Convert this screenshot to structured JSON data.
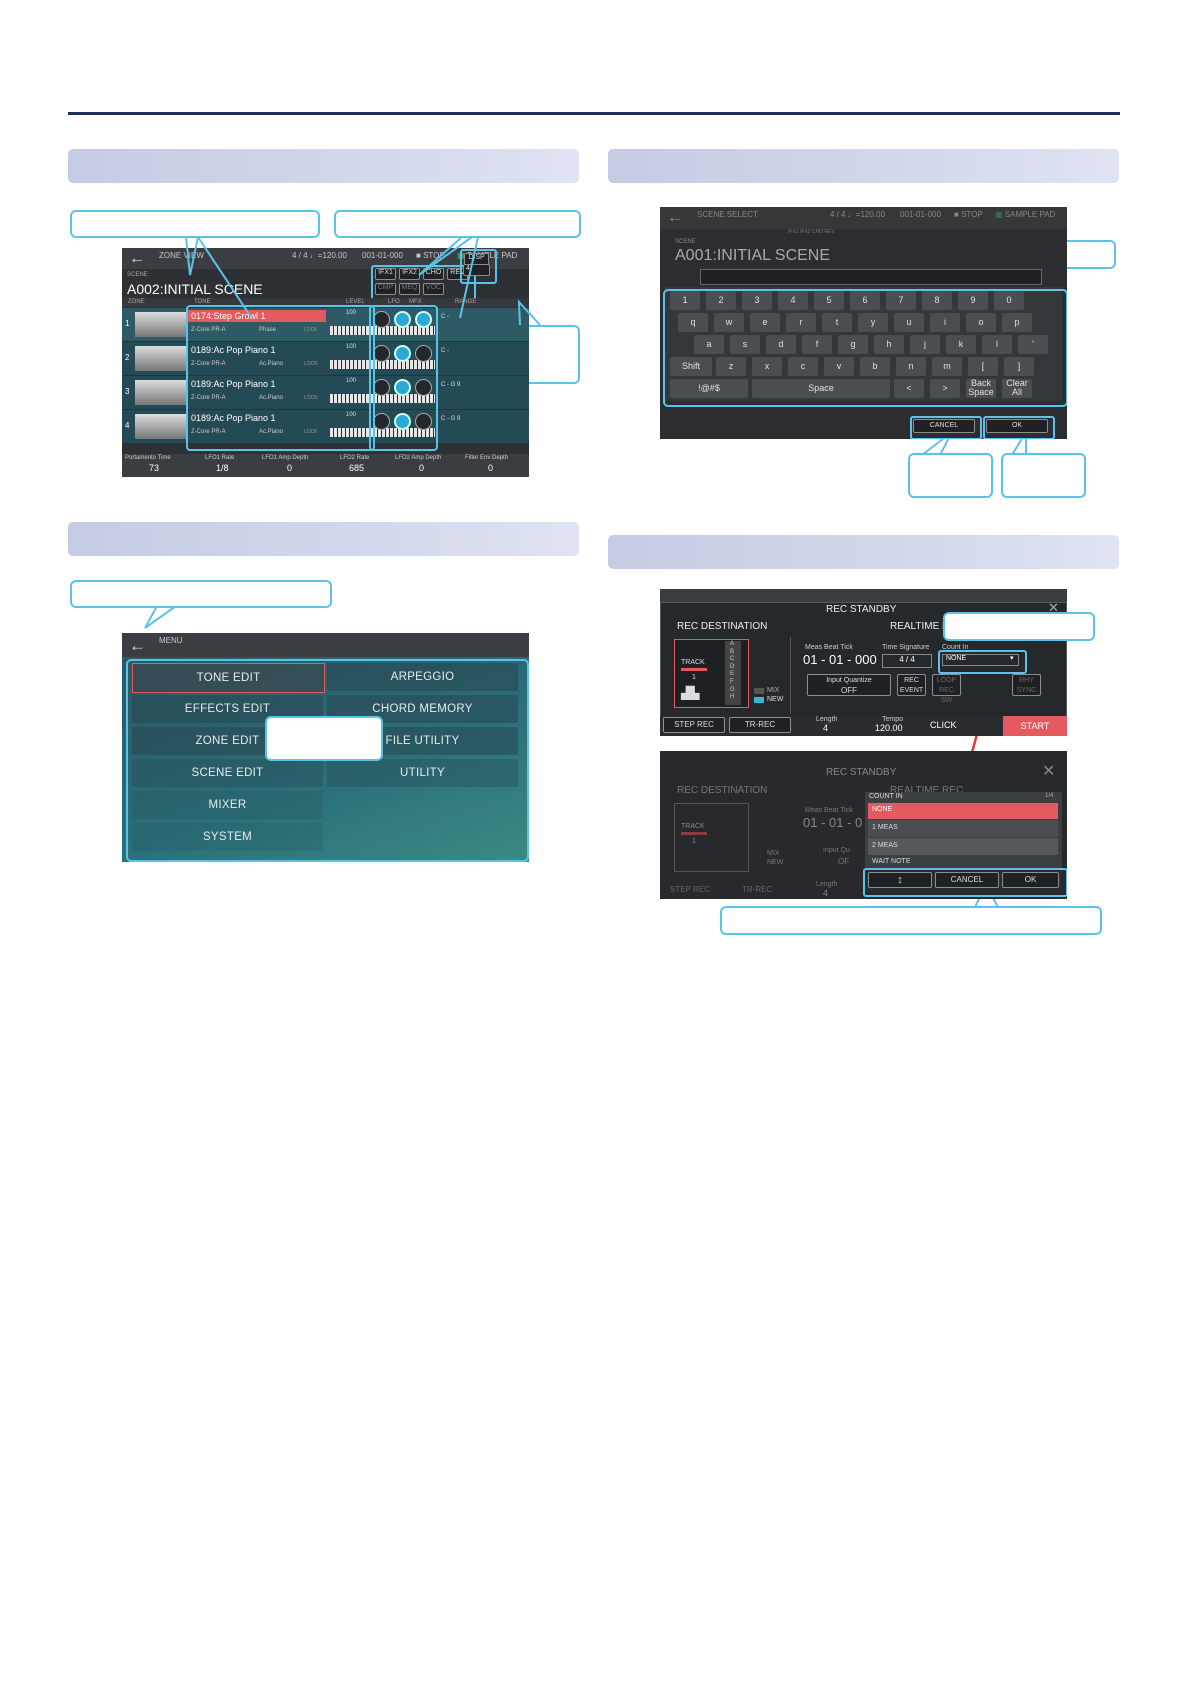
{
  "s1": {
    "title": "ZONE VIEW",
    "tempo": "4 / 4 ♩=120.00",
    "pos": "001-01-000",
    "stop": "STOP",
    "pad": "SAMPLE PAD",
    "scene_label": "SCENE",
    "scene_name": "A002:INITIAL SCENE",
    "zone_col": "ZONE",
    "tone_col": "TONE",
    "level_col": "LEVEL",
    "lower_col": "LFO",
    "mfx_col": "MFX",
    "range_col": "RANGE",
    "fx_btns": [
      "IFX1",
      "IFX2",
      "CHO",
      "REV",
      "CMP",
      "MEQ",
      "VOC"
    ],
    "disp": "DISP",
    "disp_val": "4",
    "rows": [
      {
        "num": "1",
        "name": "0174:Step Growl 1",
        "bank": "Z-Core PR-A",
        "cat": "Phase",
        "lock": "LOCK",
        "level": "100",
        "range": "C -"
      },
      {
        "num": "2",
        "name": "0189:Ac Pop Piano 1",
        "bank": "Z-Core PR-A",
        "cat": "Ac.Piano",
        "lock": "LOCK",
        "level": "100",
        "range": "C -"
      },
      {
        "num": "3",
        "name": "0189:Ac Pop Piano 1",
        "bank": "Z-Core PR-A",
        "cat": "Ac.Piano",
        "lock": "LOCK",
        "level": "100",
        "range": "C - G 9"
      },
      {
        "num": "4",
        "name": "0189:Ac Pop Piano 1",
        "bank": "Z-Core PR-A",
        "cat": "Ac.Piano",
        "lock": "LOCK",
        "level": "100",
        "range": "C - G 9"
      }
    ],
    "footer": [
      {
        "label": "Portamento Time",
        "val": "73"
      },
      {
        "label": "LFO1 Rate",
        "val": "1/8"
      },
      {
        "label": "LFO1 Amp Depth",
        "val": "0"
      },
      {
        "label": "LFO2 Rate",
        "val": "685"
      },
      {
        "label": "LFO2 Amp Depth",
        "val": "0"
      },
      {
        "label": "Filter Env Depth",
        "val": "0"
      }
    ]
  },
  "s2": {
    "title": "MENU",
    "items": [
      "TONE EDIT",
      "ARPEGGIO",
      "EFFECTS EDIT",
      "CHORD MEMORY",
      "ZONE EDIT",
      "FILE UTILITY",
      "SCENE EDIT",
      "UTILITY",
      "MIXER",
      "",
      "SYSTEM",
      ""
    ]
  },
  "s3": {
    "title": "SCENE SELECT",
    "tempo": "4 / 4 ♩=120.00",
    "pos": "001-01-000",
    "stop": "STOP",
    "pad": "SAMPLE PAD",
    "fx": "IFX1 IFX2 CHO REV",
    "scene_label": "SCENE",
    "scene_name": "A001:INITIAL SCENE",
    "row1": [
      "1",
      "2",
      "3",
      "4",
      "5",
      "6",
      "7",
      "8",
      "9",
      "0"
    ],
    "row2": [
      "q",
      "w",
      "e",
      "r",
      "t",
      "y",
      "u",
      "i",
      "o",
      "p"
    ],
    "row3": [
      "a",
      "s",
      "d",
      "f",
      "g",
      "h",
      "j",
      "k",
      "l",
      "'"
    ],
    "row4": [
      "Shift",
      "z",
      "x",
      "c",
      "v",
      "b",
      "n",
      "m",
      "[",
      "]"
    ],
    "sym": "!@#$",
    "space": "Space",
    "lt": "<",
    "gt": ">",
    "back1": "Back",
    "back2": "Space",
    "clear1": "Clear",
    "clear2": "All",
    "cancel": "CANCEL",
    "ok": "OK"
  },
  "s4": {
    "title": "REC STANDBY",
    "rec_dest": "REC DESTINATION",
    "realtime": "REALTIME REC",
    "track": "TRACK",
    "track_num": "1",
    "letters": [
      "A",
      "B",
      "C",
      "D",
      "E",
      "F",
      "G",
      "H"
    ],
    "mix": "MIX",
    "new": "NEW",
    "mbt_label": "Meas  Beat   Tick",
    "mbt_val": "01 - 01 - 000",
    "ts_label": "Time Signature",
    "ts_val": "4 / 4",
    "count_label": "Count In",
    "count_val": "NONE",
    "iq1": "Input Quantize",
    "iq2": "OFF",
    "rec_event1": "REC",
    "rec_event2": "EVENT",
    "loop1": "LOOP",
    "loop2": "REC SW",
    "rhy1": "RHY",
    "rhy2": "SYNC",
    "step_rec": "STEP REC",
    "tr_rec": "TR-REC",
    "length_label": "Length",
    "length_val": "4",
    "tempo_label": "Tempo",
    "tempo_val": "120.00",
    "click": "CLICK",
    "start": "START",
    "popup_title": "COUNT IN",
    "popup_page": "1/4",
    "options": [
      "NONE",
      "1 MEAS",
      "2 MEAS",
      "WAIT NOTE"
    ],
    "updown": "↕",
    "cancel": "CANCEL",
    "ok": "OK",
    "mbt2": "Meas  Beat  Tick",
    "mbt2_val": "01 - 01 - 0",
    "iq_short": "Input Qu",
    "iq_short2": "OF",
    "len2": "Length",
    "len2_val": "4"
  }
}
